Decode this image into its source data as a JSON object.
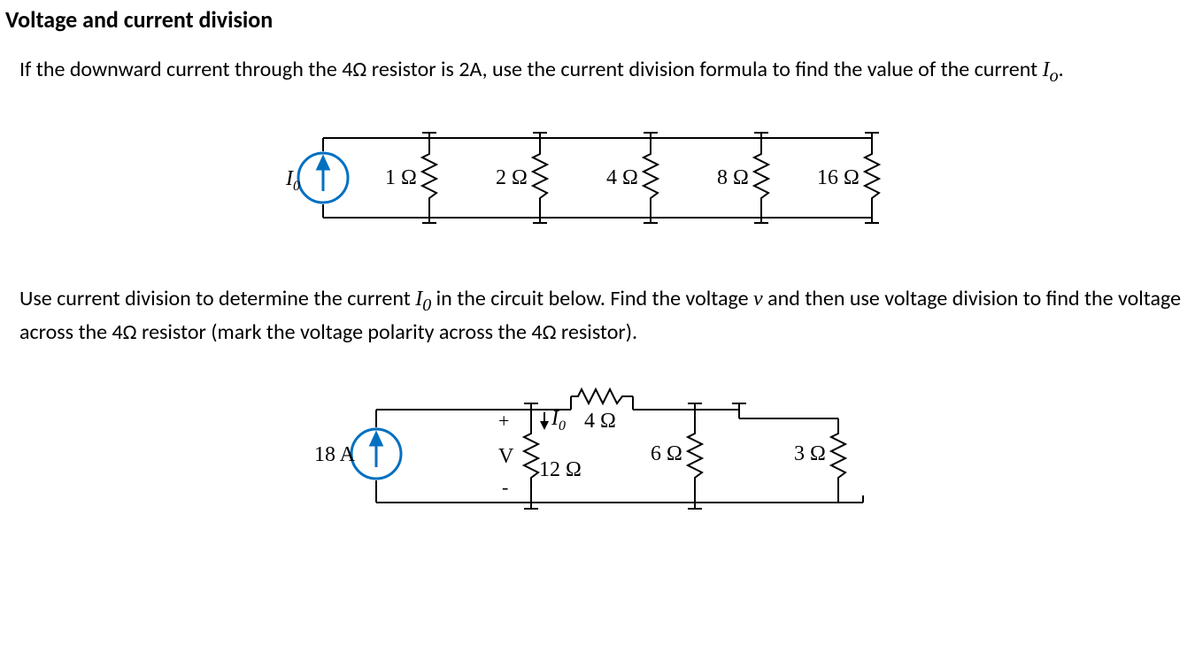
{
  "heading": "Voltage and current division",
  "problem1_text": "If the downward current through the 4Ω resistor is 2A, use the current division formula to find the value of the current ",
  "problem1_var": "I",
  "problem1_sub": "o",
  "problem1_period": ".",
  "circuit1": {
    "source_label": "I",
    "source_sub": "0",
    "r1": "1 Ω",
    "r2": "2 Ω",
    "r3": "4 Ω",
    "r4": "8 Ω",
    "r5": "16 Ω"
  },
  "problem2_textA": "Use current division to determine the current ",
  "problem2_var": "I",
  "problem2_sub": "0",
  "problem2_textB": " in the circuit below.   Find the voltage ",
  "problem2_v": "v",
  "problem2_textC": " and then use voltage division to find the voltage across the 4Ω resistor (mark the voltage polarity across the 4Ω resistor).",
  "circuit2": {
    "source_label": "18 A",
    "v_label": "V",
    "plus": "+",
    "minus": "-",
    "io_label": "I",
    "io_sub": "0",
    "r_series": "4 Ω",
    "r12": "12 Ω",
    "r6": "6 Ω",
    "r3": "3 Ω"
  }
}
